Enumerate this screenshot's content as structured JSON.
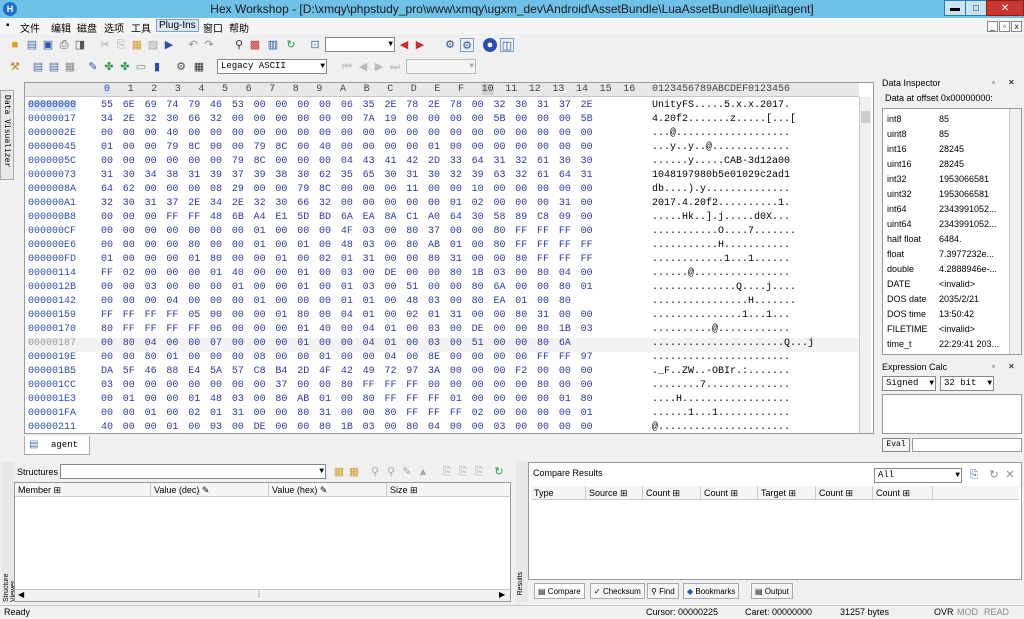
{
  "window": {
    "title": "Hex Workshop - [D:\\xmqy\\phpstudy_pro\\www\\xmqy\\ugxm_dev\\Android\\AssetBundle\\LuaAssetBundle\\luajit\\agent]",
    "minimize": "▬",
    "maximize": "□",
    "close": "✕"
  },
  "app_icon": "H",
  "menu": [
    "文件",
    "编辑",
    "磁盘",
    "选项",
    "工具",
    "Plug-Ins",
    "窗口",
    "帮助"
  ],
  "mdi": [
    "_",
    "▫",
    "x"
  ],
  "toolbar": {
    "encoding": "Legacy ASCII"
  },
  "visualizer_tab": "Data Visualizer",
  "hex": {
    "columns": [
      "0",
      "1",
      "2",
      "3",
      "4",
      "5",
      "6",
      "7",
      "8",
      "9",
      "A",
      "B",
      "C",
      "D",
      "E",
      "F",
      "10",
      "11",
      "12",
      "13",
      "14",
      "15",
      "16"
    ],
    "ascii_header": "0123456789ABCDEF0123456",
    "rows": [
      {
        "addr": "00000000",
        "hex": "55 6E 69 74 79 46 53 00 00 00 00 06 35 2E 78 2E 78 00 32 30 31 37 2E",
        "asc": "UnityFS.....5.x.x.2017."
      },
      {
        "addr": "00000017",
        "hex": "34 2E 32 30 66 32 00 00 00 00 00 00 7A 19 00 00 00 00 5B 00 00 00 5B",
        "asc": "4.20f2.......z.....[...["
      },
      {
        "addr": "0000002E",
        "hex": "00 00 00 40 00 00 00 00 00 00 00 00 00 00 00 00 00 00 00 00 00 00 00",
        "asc": "...@..................."
      },
      {
        "addr": "00000045",
        "hex": "01 00 00 79 8C 00 00 79 8C 00 40 00 00 00 00 01 00 00 00 00 00 00 00",
        "asc": "...y..y..@............."
      },
      {
        "addr": "0000005C",
        "hex": "00 00 00 00 00 00 79 8C 00 00 00 04 43 41 42 2D 33 64 31 32 61 30 30",
        "asc": "......y.....CAB-3d12a00"
      },
      {
        "addr": "00000073",
        "hex": "31 30 34 38 31 39 37 39 38 30 62 35 65 30 31 30 32 39 63 32 61 64 31",
        "asc": "1048197980b5e01029c2ad1"
      },
      {
        "addr": "0000008A",
        "hex": "64 62 00 00 00 08 29 00 00 79 8C 00 00 00 11 00 00 10 00 00 00 00 00",
        "asc": "db....).y.............."
      },
      {
        "addr": "000000A1",
        "hex": "32 30 31 37 2E 34 2E 32 30 66 32 00 00 00 00 00 01 02 00 00 00 31 00",
        "asc": "2017.4.20f2..........1."
      },
      {
        "addr": "000000B8",
        "hex": "00 00 00 FF FF 48 6B A4 E1 5D BD 6A EA 8A C1 A0 64 30 58 89 C8 09 00",
        "asc": ".....Hk..].j.....d0X..."
      },
      {
        "addr": "000000CF",
        "hex": "00 00 00 00 00 00 00 01 00 00 00 4F 03 00 80 37 00 00 80 FF FF FF 00",
        "asc": "...........O....7......."
      },
      {
        "addr": "000000E6",
        "hex": "00 00 00 00 80 00 00 01 00 01 00 48 03 00 80 AB 01 00 80 FF FF FF FF",
        "asc": "...........H..........."
      },
      {
        "addr": "000000FD",
        "hex": "01 00 00 00 01 80 00 00 01 00 02 01 31 00 00 80 31 00 00 80 FF FF FF",
        "asc": "............1...1......"
      },
      {
        "addr": "00000114",
        "hex": "FF 02 00 00 00 01 40 00 00 01 00 03 00 DE 00 00 80 1B 03 00 80 04 00",
        "asc": "......@................"
      },
      {
        "addr": "0000012B",
        "hex": "00 00 03 00 00 00 01 00 00 01 00 01 03 00 51 00 00 80 6A 00 00 80 01",
        "asc": "..............Q....j...."
      },
      {
        "addr": "00000142",
        "hex": "00 00 00 04 00 00 00 01 00 00 00 01 01 00 48 03 00 80 EA 01 00 80",
        "asc": "................H......."
      },
      {
        "addr": "00000159",
        "hex": "FF FF FF FF 05 00 00 00 01 80 00 04 01 00 02 01 31 00 00 80 31 00 00",
        "asc": "...............1...1..."
      },
      {
        "addr": "00000170",
        "hex": "80 FF FF FF FF 06 00 00 00 01 40 00 04 01 00 03 00 DE 00 00 80 1B 03",
        "asc": "..........@............"
      },
      {
        "addr": "00000187",
        "hex": "00 80 04 00 00 07 00 00 00 01 00 00 04 01 00 03 00 51 00 00 80 6A",
        "asc": "......................Q...j"
      },
      {
        "addr": "0000019E",
        "hex": "00 00 80 01 00 00 00 08 00 00 01 00 00 04 00 8E 00 00 00 00 FF FF 97",
        "asc": "......................."
      },
      {
        "addr": "000001B5",
        "hex": "DA 5F 46 88 E4 5A 57 C8 B4 2D 4F 42 49 72 97 3A 00 00 00 F2 00 00 00",
        "asc": "._F..ZW..-OBIr.:......."
      },
      {
        "addr": "000001CC",
        "hex": "03 00 00 00 00 00 00 00 37 00 00 80 FF FF FF 00 00 00 00 00 80 00 00",
        "asc": "........7.............."
      },
      {
        "addr": "000001E3",
        "hex": "00 01 00 00 01 48 03 00 80 AB 01 00 80 FF FF FF 01 00 00 00 00 01 80",
        "asc": "....H.................."
      },
      {
        "addr": "000001FA",
        "hex": "00 00 01 00 02 01 31 00 00 80 31 00 00 80 FF FF FF 02 00 00 00 00 01",
        "asc": "......1...1............"
      },
      {
        "addr": "00000211",
        "hex": "40 00 00 01 00 03 00 DE 00 00 80 1B 03 00 80 04 00 00 03 00 00 00 00",
        "asc": "@......................"
      }
    ]
  },
  "doc_tab": "agent",
  "data_inspector": {
    "title": "Data Inspector",
    "subtitle": "Data at offset 0x00000000:",
    "rows": [
      [
        "int8",
        "85"
      ],
      [
        "uint8",
        "85"
      ],
      [
        "int16",
        "28245"
      ],
      [
        "uint16",
        "28245"
      ],
      [
        "int32",
        "1953066581"
      ],
      [
        "uint32",
        "1953066581"
      ],
      [
        "int64",
        "2343991052..."
      ],
      [
        "uint64",
        "2343991052..."
      ],
      [
        "half float",
        "6484."
      ],
      [
        "float",
        "7.3977232e..."
      ],
      [
        "double",
        "4.2888946e-..."
      ],
      [
        "DATE",
        "<invalid>"
      ],
      [
        "DOS date",
        "2035/2/21"
      ],
      [
        "DOS time",
        "13:50:42"
      ],
      [
        "FILETIME",
        "<invalid>"
      ],
      [
        "time_t",
        "22:29:41 203..."
      ]
    ]
  },
  "expr_calc": {
    "title": "Expression Calc",
    "sign": "Signed",
    "bits": "32 bit",
    "eval": "Eval"
  },
  "structures": {
    "title": "Structures",
    "cols": [
      "Member",
      "Value (dec)",
      "Value (hex)",
      "Size"
    ],
    "side_label": "Structure Viewer"
  },
  "compare": {
    "title": "Compare Results",
    "filter": "All",
    "cols": [
      "Type",
      "Source",
      "Count",
      "Count",
      "Target",
      "Count",
      "Count"
    ],
    "tabs": [
      "Compare",
      "Checksum",
      "Find",
      "Bookmarks",
      "Output"
    ],
    "side_label": "Results"
  },
  "status": {
    "ready": "Ready",
    "cursor": "Cursor: 00000225",
    "caret": "Caret: 00000000",
    "size": "31257 bytes",
    "ovr": "OVR",
    "mod": "MOD",
    "read": "READ"
  }
}
